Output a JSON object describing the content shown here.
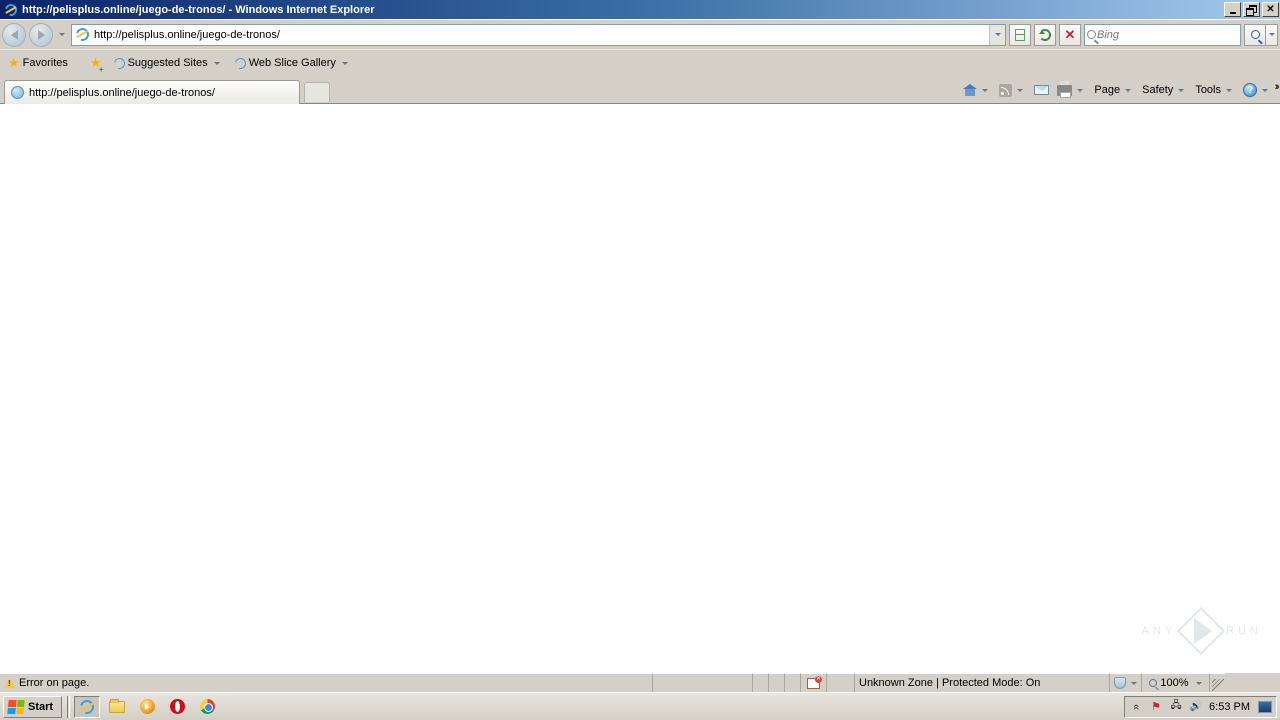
{
  "window": {
    "title": "http://pelisplus.online/juego-de-tronos/ - Windows Internet Explorer"
  },
  "nav": {
    "url": "http://pelisplus.online/juego-de-tronos/"
  },
  "search": {
    "placeholder": "Bing"
  },
  "favoritesbar": {
    "favorites_label": "Favorites",
    "suggested_sites": "Suggested Sites",
    "web_slice_gallery": "Web Slice Gallery"
  },
  "tabs": {
    "active_title": "http://pelisplus.online/juego-de-tronos/"
  },
  "commandbar": {
    "page": "Page",
    "safety": "Safety",
    "tools": "Tools"
  },
  "statusbar": {
    "message": "Error on page.",
    "zone": "Unknown Zone | Protected Mode: On",
    "zoom": "100%"
  },
  "taskbar": {
    "start": "Start",
    "clock": "6:53 PM"
  },
  "watermark": {
    "left": "ANY",
    "right": "RUN"
  }
}
